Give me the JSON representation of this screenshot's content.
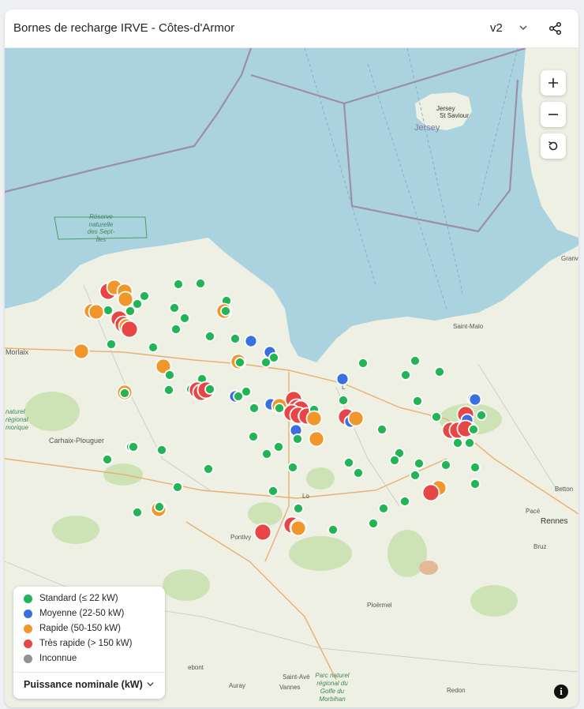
{
  "header": {
    "title": "Bornes de recharge IRVE - Côtes-d'Armor",
    "version": "v2"
  },
  "map_labels": {
    "jersey_island": "Jersey",
    "jersey_town": "Jersey",
    "saint_saviour": "St Saviour",
    "reserve": "Réserve naturelle des Sept-Îles",
    "morlaix": "Morlaix",
    "saint_malo": "Saint-Malo",
    "carhaix": "Carhaix-Plouguer",
    "pontivy": "Pontivy",
    "ploermel": "Ploërmel",
    "rennes": "Rennes",
    "betton": "Betton",
    "pace": "Pacé",
    "bruz": "Bruz",
    "granville": "Granv",
    "auray": "Auray",
    "vannes": "Vannes",
    "saint_avé": "Saint-Avé",
    "redon": "Redon",
    "lebont": "ebont",
    "lorient_fragment": "Lo",
    "saint_brieuc_fragment": "L",
    "parc_armorique": "naturel régional morique",
    "parc_golfe": "Parc naturel régional du Golfe du Morbihan"
  },
  "legend": {
    "items": [
      {
        "label": "Standard (≤ 22 kW)",
        "color": "#22b455"
      },
      {
        "label": "Moyenne (22-50 kW)",
        "color": "#3b6fe0"
      },
      {
        "label": "Rapide (50-150 kW)",
        "color": "#f0962b"
      },
      {
        "label": "Très rapide (> 150 kW)",
        "color": "#e84646"
      },
      {
        "label": "Inconnue",
        "color": "#8f9297"
      }
    ],
    "selector_label": "Puissance nominale (kW)"
  },
  "colors": {
    "standard": "#22b455",
    "medium": "#3b6fe0",
    "fast": "#f0962b",
    "ultra": "#e84646",
    "sea": "#abd3df",
    "land": "#eef0e4"
  },
  "controls": {
    "zoom_in": "zoom-in",
    "zoom_out": "zoom-out",
    "reset": "reset-view",
    "info": "info"
  }
}
